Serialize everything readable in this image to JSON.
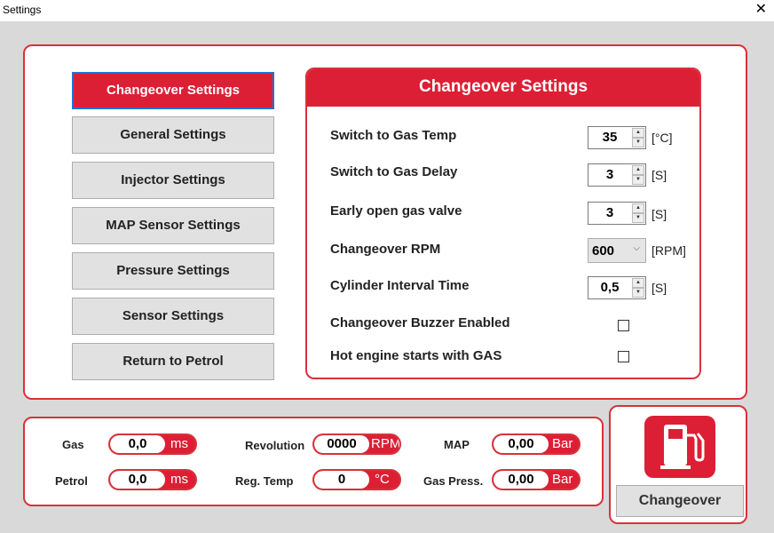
{
  "window": {
    "title": "Settings",
    "close_glyph": "✕"
  },
  "nav": {
    "items": [
      {
        "label": "Changeover Settings",
        "active": true
      },
      {
        "label": "General Settings"
      },
      {
        "label": "Injector Settings"
      },
      {
        "label": "MAP Sensor Settings"
      },
      {
        "label": "Pressure Settings"
      },
      {
        "label": "Sensor Settings"
      },
      {
        "label": "Return to Petrol"
      }
    ]
  },
  "settings": {
    "title": "Changeover Settings",
    "rows": {
      "gas_temp": {
        "label": "Switch to Gas Temp",
        "value": "35",
        "unit": "[°C]"
      },
      "gas_delay": {
        "label": "Switch to Gas Delay",
        "value": "3",
        "unit": "[S]"
      },
      "early_open": {
        "label": "Early open gas valve",
        "value": "3",
        "unit": "[S]"
      },
      "rpm": {
        "label": "Changeover RPM",
        "value": "600",
        "unit": "[RPM]"
      },
      "cyl_interval": {
        "label": "Cylinder Interval Time",
        "value": "0,5",
        "unit": "[S]"
      },
      "buzzer": {
        "label": "Changeover Buzzer Enabled",
        "checked": false
      },
      "hot_engine": {
        "label": "Hot engine starts with GAS",
        "checked": false
      }
    }
  },
  "readouts": {
    "gas": {
      "label": "Gas",
      "value": "0,0",
      "unit": "ms"
    },
    "petrol": {
      "label": "Petrol",
      "value": "0,0",
      "unit": "ms"
    },
    "revolution": {
      "label": "Revolution",
      "value": "0000",
      "unit": "RPM"
    },
    "reg_temp": {
      "label": "Reg. Temp",
      "value": "0",
      "unit": "°C"
    },
    "map": {
      "label": "MAP",
      "value": "0,00",
      "unit": "Bar"
    },
    "gas_press": {
      "label": "Gas Press.",
      "value": "0,00",
      "unit": "Bar"
    }
  },
  "changeover": {
    "button_label": "Changeover",
    "icon": "fuel-pump-icon"
  },
  "colors": {
    "accent": "#dc1f35",
    "focus": "#1e73d8",
    "button_bg": "#e1e1e1"
  }
}
